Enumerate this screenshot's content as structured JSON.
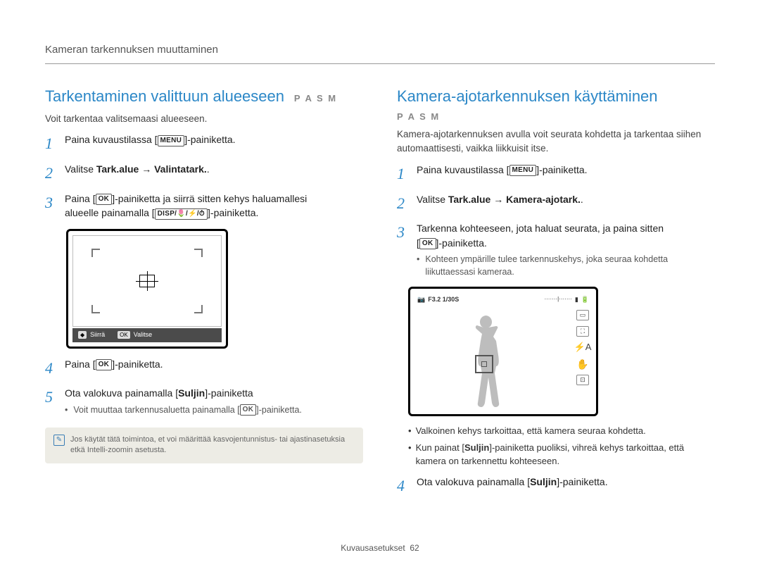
{
  "breadcrumb": "Kameran tarkennuksen muuttaminen",
  "left": {
    "heading": "Tarkentaminen valittuun alueeseen",
    "modes": "P A S M",
    "intro": "Voit tarkentaa valitsemaasi alueeseen.",
    "steps": {
      "s1": {
        "pre": "Paina kuvaustilassa [",
        "btn": "MENU",
        "post": "]-painiketta."
      },
      "s2": {
        "pre": "Valitse ",
        "bold": "Tark.alue → Valintatark.",
        "post": "."
      },
      "s3a": {
        "pre": "Paina [",
        "btn": "OK",
        "post": "]-painiketta ja siirrä sitten kehys haluamallesi"
      },
      "s3b": {
        "pre": "alueelle painamalla [",
        "btn": "DISP/🌷/⚡/⏱",
        "post": "]-painiketta."
      },
      "s4": {
        "pre": "Paina [",
        "btn": "OK",
        "post": "]-painiketta."
      },
      "s5": {
        "pre": "Ota valokuva painamalla [",
        "bold": "Suljin",
        "post": "]-painiketta"
      },
      "s5sub": {
        "pre": "Voit muuttaa tarkennusaluetta painamalla [",
        "btn": "OK",
        "post": "]-painiketta."
      }
    },
    "screen": {
      "statusLeftIcon": "◆",
      "statusLeft": "Siirrä",
      "statusRightIcon": "OK",
      "statusRight": "Valitse"
    },
    "note": "Jos käytät tätä toimintoa, et voi määrittää kasvojentunnistus- tai ajastinasetuksia etkä Intelli-zoomin asetusta."
  },
  "right": {
    "heading": "Kamera-ajotarkennuksen käyttäminen",
    "modes": "P A S M",
    "intro": "Kamera-ajotarkennuksen avulla voit seurata kohdetta ja tarkentaa siihen automaattisesti, vaikka liikkuisit itse.",
    "steps": {
      "s1": {
        "pre": "Paina kuvaustilassa [",
        "btn": "MENU",
        "post": "]-painiketta."
      },
      "s2": {
        "pre": "Valitse ",
        "bold": "Tark.alue → Kamera-ajotark.",
        "post": "."
      },
      "s3a": "Tarkenna kohteeseen, jota haluat seurata, ja paina sitten",
      "s3b": {
        "pre": "[",
        "btn": "OK",
        "post": "]-painiketta."
      },
      "s3sub": "Kohteen ympärille tulee tarkennuskehys, joka seuraa kohdetta liikuttaessasi kameraa.",
      "s4": {
        "pre": "Ota valokuva painamalla [",
        "bold": "Suljin",
        "post": "]-painiketta."
      }
    },
    "screenTop": "F3.2  1/30S",
    "bullets": {
      "b1": "Valkoinen kehys tarkoittaa, että kamera seuraa kohdetta.",
      "b2": {
        "pre": "Kun painat [",
        "bold": "Suljin",
        "post": "]-painiketta puoliksi, vihreä kehys tarkoittaa, että kamera on tarkennettu kohteeseen."
      }
    }
  },
  "footer": {
    "section": "Kuvausasetukset",
    "page": "62"
  }
}
